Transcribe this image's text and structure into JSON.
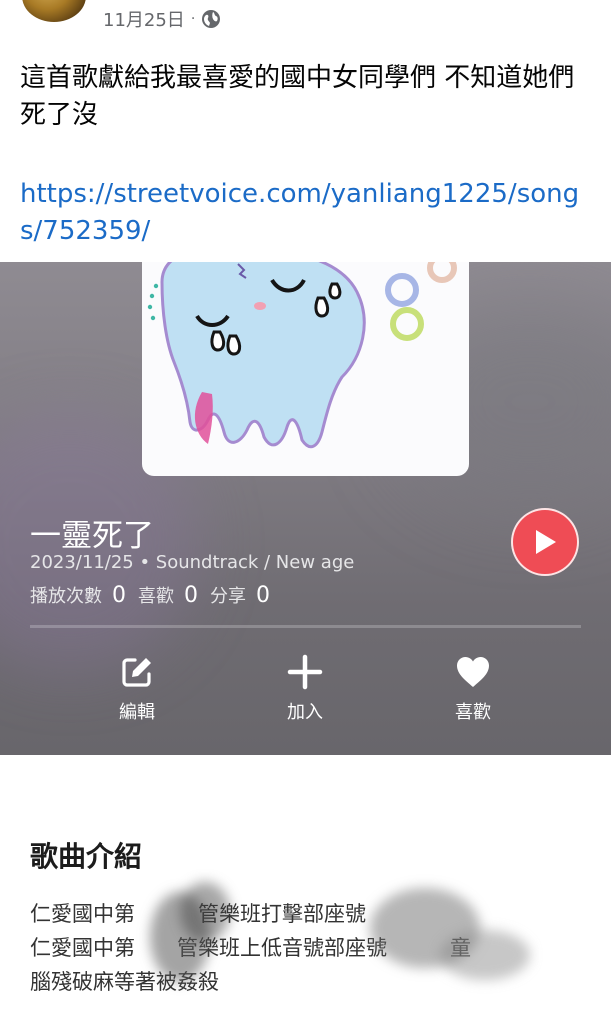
{
  "post": {
    "date": "11月25日",
    "separator": "·",
    "text": "這首歌獻給我最喜愛的國中女同學們 不知道她們死了沒",
    "link": "https://streetvoice.com/yanliang1225/songs/752359/"
  },
  "player": {
    "song_title": "一靈死了",
    "meta": "2023/11/25 • Soundtrack / New age",
    "stats": [
      {
        "label": "播放次數",
        "value": "0"
      },
      {
        "label": "喜歡",
        "value": "0"
      },
      {
        "label": "分享",
        "value": "0"
      }
    ],
    "actions": [
      {
        "label": "編輯",
        "icon": "edit-icon"
      },
      {
        "label": "加入",
        "icon": "plus-icon"
      },
      {
        "label": "喜歡",
        "icon": "heart-icon"
      }
    ],
    "play_color": "#ef4c55"
  },
  "intro": {
    "heading": "歌曲介紹",
    "lines": [
      "仁愛國中第　　　管樂班打擊部座號",
      "仁愛國中第　　管樂班上低音號部座號　　　童",
      "腦殘破麻等著被姦殺"
    ]
  }
}
